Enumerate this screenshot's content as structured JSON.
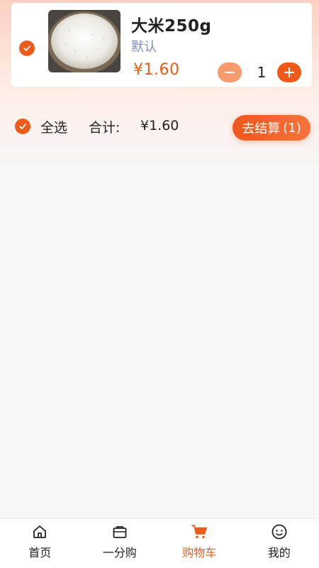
{
  "cart": {
    "items": [
      {
        "name": "大米250g",
        "spec": "默认",
        "price": "¥1.60",
        "quantity": "1",
        "selected": true
      }
    ]
  },
  "summary": {
    "select_all_label": "全选",
    "total_label": "合计:",
    "total_value": "¥1.60",
    "checkout_label": "去结算",
    "checkout_count": "(1)"
  },
  "tabbar": {
    "tabs": [
      {
        "label": "首页",
        "icon": "home-icon",
        "active": false
      },
      {
        "label": "一分购",
        "icon": "shopping-bag-icon",
        "active": false
      },
      {
        "label": "购物车",
        "icon": "cart-icon",
        "active": true
      },
      {
        "label": "我的",
        "icon": "smiley-icon",
        "active": false
      }
    ]
  },
  "colors": {
    "accent": "#ee5a1a",
    "accent_light": "#f79a6c",
    "spec_text": "#7c8fb8"
  }
}
